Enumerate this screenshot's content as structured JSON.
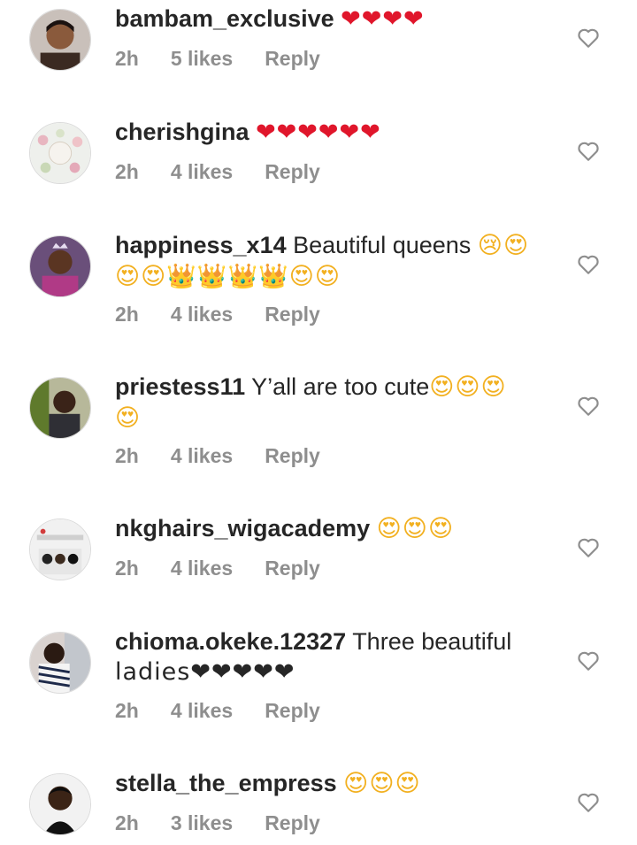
{
  "comments": [
    {
      "username": "bambam_exclusive",
      "text": "",
      "emoji": "❤❤❤❤",
      "emoji2": "",
      "time": "2h",
      "likes": "5 likes",
      "reply": "Reply"
    },
    {
      "username": "cherishgina",
      "text": "",
      "emoji": "❤❤❤❤❤❤",
      "emoji2": "",
      "time": "2h",
      "likes": "4 likes",
      "reply": "Reply"
    },
    {
      "username": "happiness_x14",
      "text": "Beautiful queens",
      "emoji": "😢😍",
      "emoji2": "😍😍👑👑👑👑😍😍",
      "time": "2h",
      "likes": "4 likes",
      "reply": "Reply"
    },
    {
      "username": "priestess11",
      "text": "Y’all are too cute",
      "emoji": "😍😍😍",
      "emoji2": "😍",
      "time": "2h",
      "likes": "4 likes",
      "reply": "Reply"
    },
    {
      "username": "nkghairs_wigacademy",
      "text": "",
      "emoji": "😍😍😍",
      "emoji2": "",
      "time": "2h",
      "likes": "4 likes",
      "reply": "Reply"
    },
    {
      "username": "chioma.okeke.12327",
      "text": "Three beautiful",
      "emoji": "",
      "emoji2": "ladies❤❤❤❤❤",
      "time": "2h",
      "likes": "4 likes",
      "reply": "Reply"
    },
    {
      "username": "stella_the_empress",
      "text": "",
      "emoji": "😍😍😍",
      "emoji2": "",
      "time": "2h",
      "likes": "3 likes",
      "reply": "Reply"
    }
  ],
  "icons": {
    "like": "heart-outline-icon"
  },
  "colors": {
    "meta": "#8e8e8e",
    "text": "#262626",
    "heart": "#e0162b"
  }
}
